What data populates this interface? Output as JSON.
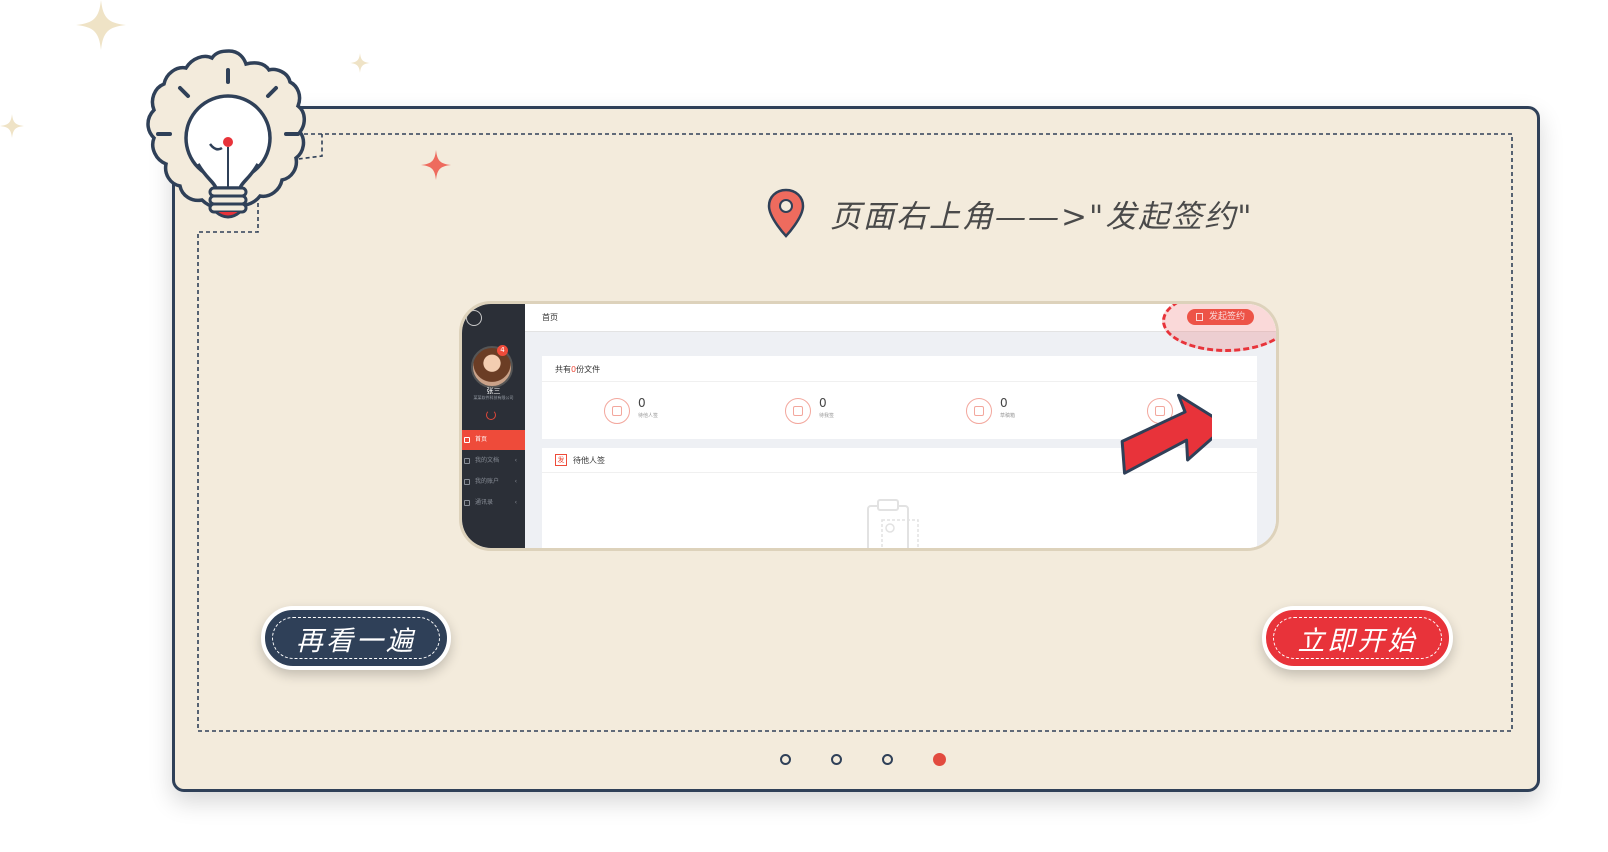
{
  "colors": {
    "card_bg": "#f3ebdc",
    "navy": "#2f4058",
    "accent_red": "#e8333a",
    "app_red": "#ee4b3a",
    "sidebar_dark": "#2b2f37"
  },
  "icons": {
    "bulb": "lightbulb-icon",
    "pin": "location-pin-icon",
    "arrow": "pointer-arrow-icon"
  },
  "tip": {
    "text": "页面右上角——>\"发起签约\""
  },
  "screenshot": {
    "breadcrumb": "首页",
    "launch_button": "发起签约",
    "user": {
      "name": "张三",
      "company": "某某软件科技有限公司",
      "badge": "4"
    },
    "menu": [
      {
        "label": "首页",
        "active": true
      },
      {
        "label": "我的文档",
        "active": false
      },
      {
        "label": "我的账户",
        "active": false
      },
      {
        "label": "通讯录",
        "active": false
      }
    ],
    "summary": {
      "prefix": "共有",
      "count": "0",
      "suffix": "份文件"
    },
    "stats": [
      {
        "value": "0",
        "label": "待他人签"
      },
      {
        "value": "0",
        "label": "待我签"
      },
      {
        "value": "0",
        "label": "草稿箱"
      }
    ],
    "section": {
      "icon_char": "发",
      "title": "待他人签"
    }
  },
  "buttons": {
    "replay": "再看一遍",
    "start": "立即开始"
  },
  "pagination": {
    "total": 4,
    "current": 4
  }
}
